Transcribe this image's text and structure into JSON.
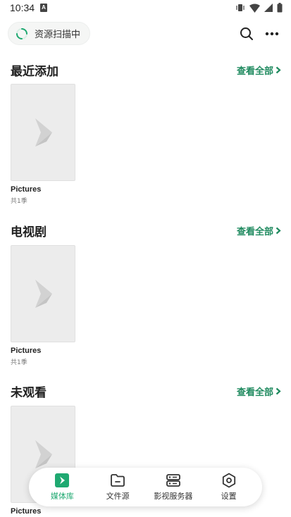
{
  "status_bar": {
    "time": "10:34",
    "notif_letter": "A"
  },
  "topbar": {
    "scan_label": "资源扫描中"
  },
  "sections": [
    {
      "title": "最近添加",
      "see_all": "查看全部",
      "items": [
        {
          "title": "Pictures",
          "subtitle": "共1季"
        }
      ]
    },
    {
      "title": "电视剧",
      "see_all": "查看全部",
      "items": [
        {
          "title": "Pictures",
          "subtitle": "共1季"
        }
      ]
    },
    {
      "title": "未观看",
      "see_all": "查看全部",
      "items": [
        {
          "title": "Pictures",
          "subtitle": ""
        }
      ]
    }
  ],
  "tabs": [
    {
      "label": "媒体库",
      "icon": "media-library-icon",
      "active": true
    },
    {
      "label": "文件源",
      "icon": "folder-icon",
      "active": false
    },
    {
      "label": "影视服务器",
      "icon": "server-icon",
      "active": false
    },
    {
      "label": "设置",
      "icon": "settings-icon",
      "active": false
    }
  ],
  "colors": {
    "accent": "#1fa971",
    "link": "#1f8a5f",
    "poster_bg": "#ececec"
  }
}
